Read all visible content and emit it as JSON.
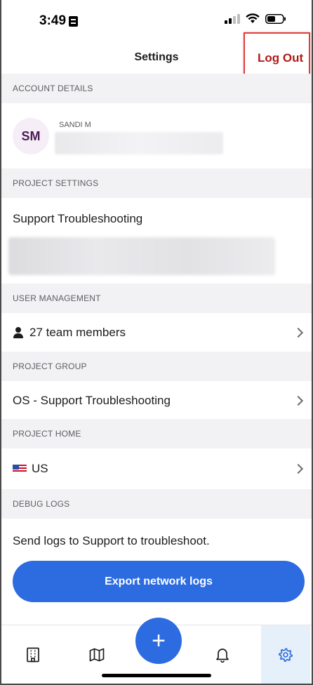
{
  "status_bar": {
    "time": "3:49"
  },
  "header": {
    "title": "Settings",
    "logout_label": "Log Out"
  },
  "account": {
    "section_label": "ACCOUNT DETAILS",
    "initials": "SM",
    "name": "SANDI M"
  },
  "project_settings": {
    "section_label": "PROJECT SETTINGS",
    "project_name": "Support Troubleshooting"
  },
  "user_management": {
    "section_label": "USER MANAGEMENT",
    "team_members": "27 team members"
  },
  "project_group": {
    "section_label": "PROJECT GROUP",
    "group_name": "OS - Support Troubleshooting"
  },
  "project_home": {
    "section_label": "PROJECT HOME",
    "region": "US"
  },
  "debug_logs": {
    "section_label": "DEBUG LOGS",
    "description": "Send logs to Support to troubleshoot.",
    "export_label": "Export network logs"
  },
  "bottom_nav": {
    "items": [
      {
        "icon": "building-icon"
      },
      {
        "icon": "map-icon"
      },
      {
        "icon": "plus-icon"
      },
      {
        "icon": "bell-icon"
      },
      {
        "icon": "gear-icon",
        "active": true
      }
    ]
  },
  "colors": {
    "accent": "#2d6be0",
    "logout": "#b01a17",
    "section_bg": "#f2f2f4",
    "active_tab_bg": "#e6f0fa",
    "highlight_border": "#e03c3c"
  }
}
